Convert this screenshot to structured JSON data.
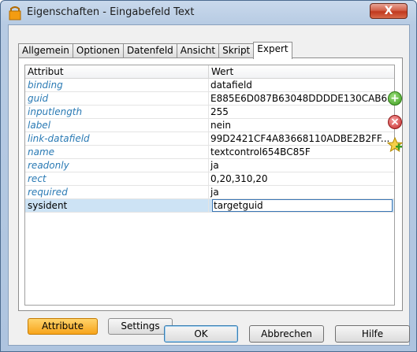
{
  "window": {
    "title": "Eigenschaften - Eingabefeld Text",
    "close_label": "X"
  },
  "tabs": [
    {
      "label": "Allgemein"
    },
    {
      "label": "Optionen"
    },
    {
      "label": "Datenfeld"
    },
    {
      "label": "Ansicht"
    },
    {
      "label": "Skript"
    },
    {
      "label": "Expert",
      "active": true
    }
  ],
  "table": {
    "headers": {
      "attribute": "Attribut",
      "value": "Wert"
    },
    "rows": [
      {
        "attribute": "binding",
        "value": "datafield"
      },
      {
        "attribute": "guid",
        "value": "E885E6D087B63048DDDDE130CAB6..."
      },
      {
        "attribute": "inputlength",
        "value": "255"
      },
      {
        "attribute": "label",
        "value": "nein"
      },
      {
        "attribute": "link-datafield",
        "value": "99D2421CF4A83668110ADBE2B2FF..."
      },
      {
        "attribute": "name",
        "value": "textcontrol654BC85F"
      },
      {
        "attribute": "readonly",
        "value": "ja"
      },
      {
        "attribute": "rect",
        "value": "0,20,310,20"
      },
      {
        "attribute": "required",
        "value": "ja"
      },
      {
        "attribute": "sysident",
        "value": "targetguid",
        "selected": true
      }
    ]
  },
  "side_buttons": {
    "add_label": "+",
    "remove_label": "×"
  },
  "bottom_toggles": {
    "attribute_label": "Attribute",
    "settings_label": "Settings"
  },
  "dialog_buttons": {
    "ok_label": "OK",
    "cancel_label": "Abbrechen",
    "help_label": "Hilfe"
  },
  "colors": {
    "accent_selected_row": "#cde3f5",
    "attribute_text": "#2a7ab4",
    "active_toggle": "#f7a41b"
  }
}
